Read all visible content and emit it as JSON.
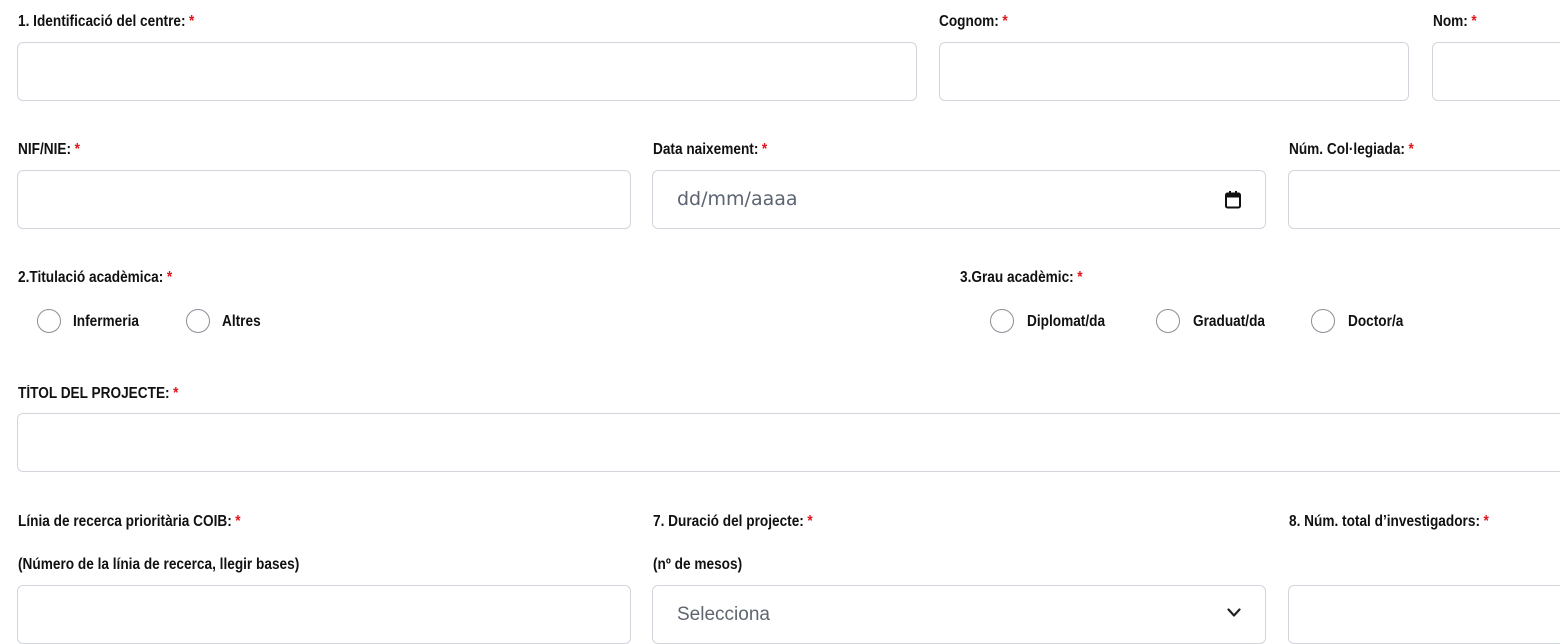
{
  "required_mark": "*",
  "fields": {
    "centre": {
      "label": "1. Identificació del centre:",
      "value": ""
    },
    "cognom": {
      "label": "Cognom:",
      "value": ""
    },
    "nom": {
      "label": "Nom:",
      "value": ""
    },
    "nif": {
      "label": "NIF/NIE:",
      "value": ""
    },
    "data_naixement": {
      "label": "Data naixement:",
      "placeholder": "dd/mm/aaaa",
      "icon": "calendar-icon"
    },
    "num_colegiada": {
      "label": "Núm. Col·legiada:",
      "value": ""
    },
    "titol": {
      "label": "TÍTOL DEL PROJECTE:",
      "value": ""
    },
    "linia": {
      "label": "Línia de recerca prioritària COIB:",
      "hint": "(Número de la línia de recerca, llegir bases)",
      "value": ""
    },
    "duracio": {
      "label": "7. Duració del projecte:",
      "hint": "(nº de mesos)",
      "selected": "Selecciona",
      "icon": "chevron-down-icon"
    },
    "num_investigadors": {
      "label": "8. Núm. total d’investigadors:",
      "value": ""
    }
  },
  "titulacio": {
    "label": "2.Titulació acadèmica:",
    "options": [
      "Infermeria",
      "Altres"
    ]
  },
  "grau": {
    "label": "3.Grau acadèmic:",
    "options": [
      "Diplomat/da",
      "Graduat/da",
      "Doctor/a"
    ]
  },
  "colors": {
    "required": "#e0161a",
    "border": "#d2d6dc",
    "text": "#111111",
    "placeholder": "#5b6470"
  }
}
